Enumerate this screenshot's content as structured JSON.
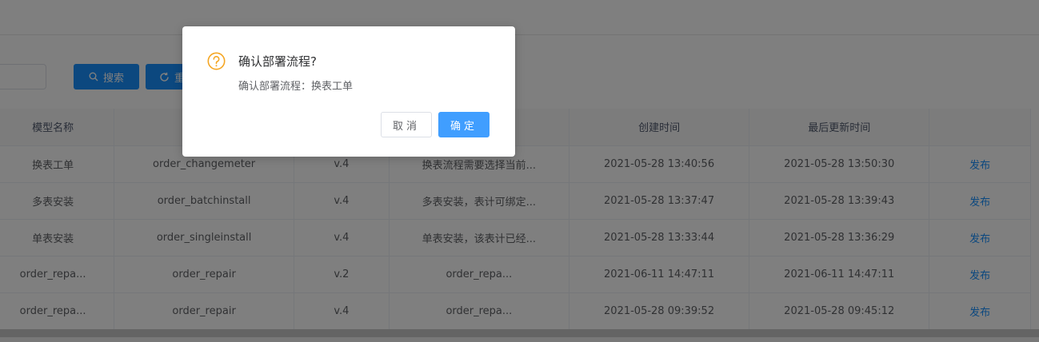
{
  "toolbar": {
    "search_label": "搜索",
    "reset_label": "重置",
    "search_input_value": ""
  },
  "table": {
    "headers": [
      "模型名称",
      "",
      "",
      "",
      "创建时间",
      "最后更新时间",
      ""
    ],
    "rows": [
      [
        "换表工单",
        "order_changemeter",
        "v.4",
        "换表流程需要选择当前...",
        "2021-05-28 13:40:56",
        "2021-05-28 13:50:30",
        "发布"
      ],
      [
        "多表安装",
        "order_batchinstall",
        "v.4",
        "多表安装，表计可绑定...",
        "2021-05-28 13:37:47",
        "2021-05-28 13:39:43",
        "发布"
      ],
      [
        "单表安装",
        "order_singleinstall",
        "v.4",
        "单表安装，该表计已经...",
        "2021-05-28 13:33:44",
        "2021-05-28 13:36:29",
        "发布"
      ],
      [
        "order_repa...",
        "order_repair",
        "v.2",
        "order_repa...",
        "2021-06-11 14:47:11",
        "2021-06-11 14:47:11",
        "发布"
      ],
      [
        "order_repa...",
        "order_repair",
        "v.4",
        "order_repa...",
        "2021-05-28 09:39:52",
        "2021-05-28 09:45:12",
        "发布"
      ]
    ]
  },
  "dialog": {
    "title": "确认部署流程?",
    "message": "确认部署流程：换表工单",
    "cancel_label": "取消",
    "ok_label": "确定",
    "icon": "question-circle-icon",
    "icon_color": "#f5a623"
  },
  "colors": {
    "primary": "#1890ff",
    "dialog_ok": "#409eff",
    "link": "#1890ff"
  }
}
